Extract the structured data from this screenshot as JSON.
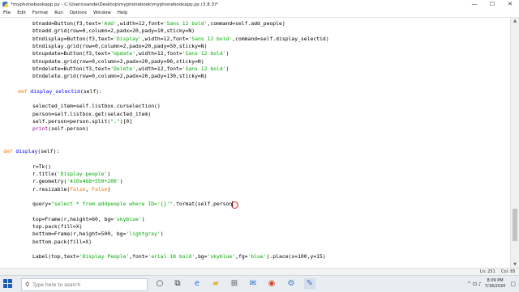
{
  "window": {
    "title": "*myphonebookapp.py - C:\\Users\\sande\\Desktop\\myphonebook\\myphonebookapp.py (3.8.3)*",
    "minimize_glyph": "—",
    "maximize_glyph": "☐",
    "close_glyph": "✕"
  },
  "menu": [
    "File",
    "Edit",
    "Format",
    "Run",
    "Options",
    "Window",
    "Help"
  ],
  "code": [
    {
      "indent": 2,
      "tokens": [
        {
          "t": "btnadd=Button(f3,text="
        },
        {
          "t": "'Add'",
          "c": "st"
        },
        {
          "t": ",width=12,font="
        },
        {
          "t": "'Sans 12 bold'",
          "c": "st"
        },
        {
          "t": ",command=self.add_people)"
        }
      ]
    },
    {
      "indent": 2,
      "tokens": [
        {
          "t": "btnadd.grid(row=0,column=2,padx=20,pady=10,sticky=N)"
        }
      ]
    },
    {
      "indent": 2,
      "tokens": [
        {
          "t": "btndisplay=Button(f3,text="
        },
        {
          "t": "'Display'",
          "c": "st"
        },
        {
          "t": ",width=12,font="
        },
        {
          "t": "'Sans 12 bold'",
          "c": "st"
        },
        {
          "t": ",command=self.display_selectid)"
        }
      ]
    },
    {
      "indent": 2,
      "tokens": [
        {
          "t": "btndisplay.grid(row=0,column=2,padx=20,pady=50,sticky=N)"
        }
      ]
    },
    {
      "indent": 2,
      "tokens": [
        {
          "t": "btnupdate=Button(f3,text="
        },
        {
          "t": "'Update'",
          "c": "st"
        },
        {
          "t": ",width=12,font="
        },
        {
          "t": "'Sans 12 bold'",
          "c": "st"
        },
        {
          "t": ")"
        }
      ]
    },
    {
      "indent": 2,
      "tokens": [
        {
          "t": "btnupdate.grid(row=0,column=2,padx=20,pady=90,sticky=N)"
        }
      ]
    },
    {
      "indent": 2,
      "tokens": [
        {
          "t": "btndelete=Button(f3,text="
        },
        {
          "t": "'Delete'",
          "c": "st"
        },
        {
          "t": ",width=12,font="
        },
        {
          "t": "'Sans 12 bold'",
          "c": "st"
        },
        {
          "t": ")"
        }
      ]
    },
    {
      "indent": 2,
      "tokens": [
        {
          "t": "btndelete.grid(row=0,column=2,padx=20,pady=130,sticky=N)"
        }
      ]
    },
    {
      "indent": 0,
      "tokens": []
    },
    {
      "indent": 1,
      "tokens": [
        {
          "t": "def",
          "c": "kw"
        },
        {
          "t": " "
        },
        {
          "t": "display_selectid",
          "c": "df"
        },
        {
          "t": "(self):"
        }
      ]
    },
    {
      "indent": 0,
      "tokens": []
    },
    {
      "indent": 2,
      "tokens": [
        {
          "t": "selected_item=self.listbox.curselection()"
        }
      ]
    },
    {
      "indent": 2,
      "tokens": [
        {
          "t": "person=self.listbox.get(selected_item)"
        }
      ]
    },
    {
      "indent": 2,
      "tokens": [
        {
          "t": "self.person=person.split("
        },
        {
          "t": "\".\"",
          "c": "st"
        },
        {
          "t": ")[0]"
        }
      ]
    },
    {
      "indent": 2,
      "tokens": [
        {
          "t": "print",
          "c": "bi"
        },
        {
          "t": "(self.person)"
        }
      ]
    },
    {
      "indent": 0,
      "tokens": []
    },
    {
      "indent": 0,
      "tokens": []
    },
    {
      "indent": 0,
      "tokens": [
        {
          "t": "def",
          "c": "kw"
        },
        {
          "t": " "
        },
        {
          "t": "display",
          "c": "df"
        },
        {
          "t": "(self):"
        }
      ]
    },
    {
      "indent": 0,
      "tokens": []
    },
    {
      "indent": 2,
      "tokens": [
        {
          "t": "r=Tk()"
        }
      ]
    },
    {
      "indent": 2,
      "tokens": [
        {
          "t": "r.title("
        },
        {
          "t": "'Display people'",
          "c": "st"
        },
        {
          "t": ")"
        }
      ]
    },
    {
      "indent": 2,
      "tokens": [
        {
          "t": "r.geometry("
        },
        {
          "t": "'410x468+550+200'",
          "c": "st"
        },
        {
          "t": ")"
        }
      ]
    },
    {
      "indent": 2,
      "tokens": [
        {
          "t": "r.resizable("
        },
        {
          "t": "False",
          "c": "kw"
        },
        {
          "t": ", "
        },
        {
          "t": "False",
          "c": "kw"
        },
        {
          "t": ")"
        }
      ]
    },
    {
      "indent": 0,
      "tokens": []
    },
    {
      "indent": 2,
      "tokens": [
        {
          "t": "query="
        },
        {
          "t": "\"select * from addpeople where ID='{}'\"",
          "c": "st"
        },
        {
          "t": ".format(self.person"
        }
      ],
      "cursor": true
    },
    {
      "indent": 0,
      "tokens": []
    },
    {
      "indent": 2,
      "tokens": [
        {
          "t": "top=Frame(r,height=60, bg="
        },
        {
          "t": "'skyblue'",
          "c": "st"
        },
        {
          "t": ")"
        }
      ]
    },
    {
      "indent": 2,
      "tokens": [
        {
          "t": "top.pack(fill=X)"
        }
      ]
    },
    {
      "indent": 2,
      "tokens": [
        {
          "t": "bottom=Frame(r,height=500, bg="
        },
        {
          "t": "'lightgray'",
          "c": "st"
        },
        {
          "t": ")"
        }
      ]
    },
    {
      "indent": 2,
      "tokens": [
        {
          "t": "bottom.pack(fill=X)"
        }
      ]
    },
    {
      "indent": 0,
      "tokens": []
    },
    {
      "indent": 2,
      "tokens": [
        {
          "t": "Label(top,text="
        },
        {
          "t": "'Display People'",
          "c": "st"
        },
        {
          "t": ",font="
        },
        {
          "t": "'arial 18 bold'",
          "c": "st"
        },
        {
          "t": ",bg="
        },
        {
          "t": "'skyblue'",
          "c": "st"
        },
        {
          "t": ",fg="
        },
        {
          "t": "'blue'",
          "c": "st"
        },
        {
          "t": ").place(x=100,y=15)"
        }
      ]
    }
  ],
  "status": {
    "line": "Ln: 251",
    "col": "Col: 85"
  },
  "taskbar": {
    "search_placeholder": "Type here to search",
    "tray_glyphs": "^ ⊡ ♪",
    "time": "8:09 PM",
    "date": "7/18/2020"
  },
  "colors": {
    "keyword": "#ff7700",
    "builtin": "#900090",
    "string": "#00aa00",
    "definition": "#0000ff"
  }
}
